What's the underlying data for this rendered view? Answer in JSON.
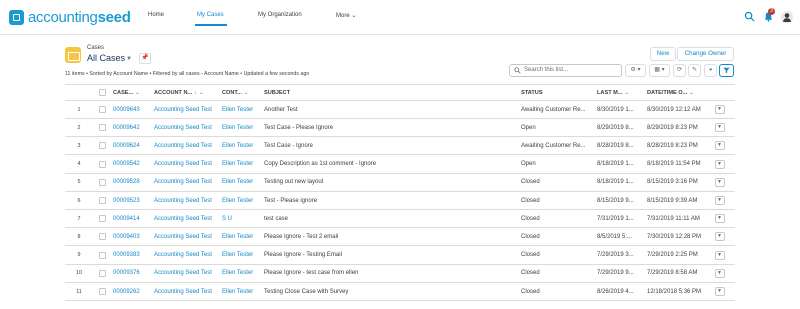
{
  "brand": {
    "part1": "accounting",
    "part2": "seed"
  },
  "nav": {
    "home": "Home",
    "my_cases": "My Cases",
    "my_org": "My Organization",
    "more": "More"
  },
  "header_icons": {
    "notifications_count": "3"
  },
  "list": {
    "object_label": "Cases",
    "view_name": "All Cases",
    "meta": "11 items • Sorted by Account Name • Filtered by all cases - Account Name • Updated a few seconds ago",
    "new_label": "New",
    "change_owner_label": "Change Owner",
    "search_placeholder": "Search this list..."
  },
  "table": {
    "headers": {
      "case": "CASE...",
      "account": "ACCOUNT N...",
      "contact": "CONT...",
      "subject": "SUBJECT",
      "status": "STATUS",
      "last_mod": "LAST M...",
      "date_time": "DATE/TIME O..."
    },
    "rows": [
      {
        "n": "1",
        "case": "00009643",
        "account": "Accounting Seed Test",
        "contact": "Ellen Tester",
        "subject": "Another Test",
        "status": "Awaiting Customer Re...",
        "last": "8/30/2019 1...",
        "dt": "8/30/2019 12:12 AM"
      },
      {
        "n": "2",
        "case": "00009642",
        "account": "Accounting Seed Test",
        "contact": "Ellen Tester",
        "subject": "Test Case - Please Ignore",
        "status": "Open",
        "last": "8/29/2019 8...",
        "dt": "8/29/2019 8:23 PM"
      },
      {
        "n": "3",
        "case": "00009624",
        "account": "Accounting Seed Test",
        "contact": "Ellen Tester",
        "subject": "Test Case - Ignore",
        "status": "Awaiting Customer Re...",
        "last": "8/28/2019 8...",
        "dt": "8/28/2019 8:23 PM"
      },
      {
        "n": "4",
        "case": "00009542",
        "account": "Accounting Seed Test",
        "contact": "Ellen Tester",
        "subject": "Copy Description as 1st comment - Ignore",
        "status": "Open",
        "last": "8/18/2019 1...",
        "dt": "8/18/2019 11:54 PM"
      },
      {
        "n": "5",
        "case": "00009528",
        "account": "Accounting Seed Test",
        "contact": "Ellen Tester",
        "subject": "Testing out new layout",
        "status": "Closed",
        "last": "8/18/2019 1...",
        "dt": "8/15/2019 3:16 PM"
      },
      {
        "n": "6",
        "case": "00009523",
        "account": "Accounting Seed Test",
        "contact": "Ellen Tester",
        "subject": "Test - Please ignore",
        "status": "Closed",
        "last": "8/15/2019 9...",
        "dt": "8/15/2019 9:39 AM"
      },
      {
        "n": "7",
        "case": "00009414",
        "account": "Accounting Seed Test",
        "contact": "S U",
        "subject": "test case",
        "status": "Closed",
        "last": "7/31/2019 1...",
        "dt": "7/31/2019 11:11 AM"
      },
      {
        "n": "8",
        "case": "00009403",
        "account": "Accounting Seed Test",
        "contact": "Ellen Tester",
        "subject": "Please Ignore - Test 2 email",
        "status": "Closed",
        "last": "8/5/2019 5:...",
        "dt": "7/30/2019 12:28 PM"
      },
      {
        "n": "9",
        "case": "00009383",
        "account": "Accounting Seed Test",
        "contact": "Ellen Tester",
        "subject": "Please Ignore - Testing Email",
        "status": "Closed",
        "last": "7/29/2019 3...",
        "dt": "7/29/2019 2:25 PM"
      },
      {
        "n": "10",
        "case": "00009376",
        "account": "Accounting Seed Test",
        "contact": "Ellen Tester",
        "subject": "Please Ignore - test case from ellen",
        "status": "Closed",
        "last": "7/29/2019 9...",
        "dt": "7/29/2019 8:58 AM"
      },
      {
        "n": "11",
        "case": "00009262",
        "account": "Accounting Seed Test",
        "contact": "Ellen Tester",
        "subject": "Testing Close Case with Survey",
        "status": "Closed",
        "last": "8/26/2019 4...",
        "dt": "12/18/2018 5:36 PM"
      }
    ]
  }
}
